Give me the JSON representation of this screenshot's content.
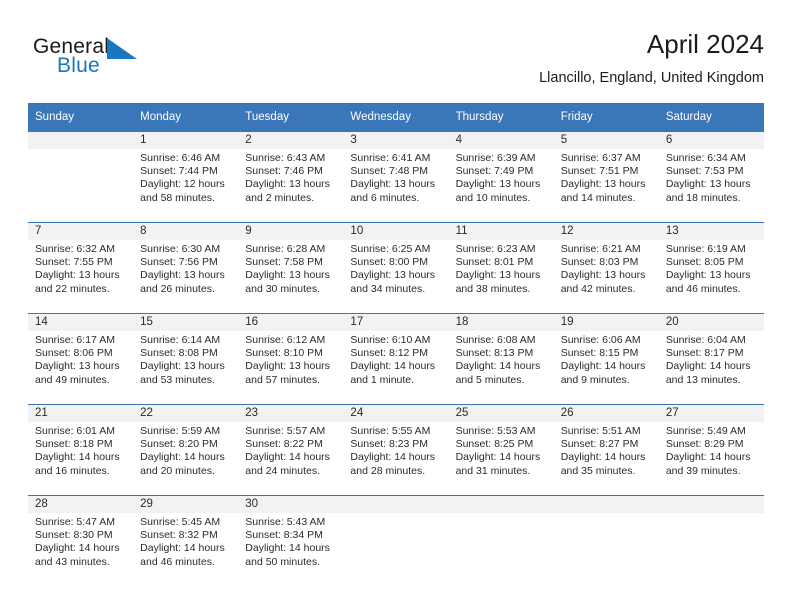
{
  "brand": {
    "name_part1": "General",
    "name_part2": "Blue",
    "flag_icon": "blue-triangle-flag-icon",
    "accent_color": "#1878be"
  },
  "header": {
    "title": "April 2024",
    "location": "Llancillo, England, United Kingdom"
  },
  "theme": {
    "header_blue": "#3a76b8",
    "daynum_band_gray": "#f2f2f2",
    "text": "#2b2b2b"
  },
  "calendar": {
    "weekday_headers": [
      "Sunday",
      "Monday",
      "Tuesday",
      "Wednesday",
      "Thursday",
      "Friday",
      "Saturday"
    ],
    "weeks": [
      [
        {
          "day": "",
          "sunrise": "",
          "sunset": "",
          "daylight_line1": "",
          "daylight_line2": "",
          "blank": true
        },
        {
          "day": "1",
          "sunrise": "Sunrise: 6:46 AM",
          "sunset": "Sunset: 7:44 PM",
          "daylight_line1": "Daylight: 12 hours",
          "daylight_line2": "and 58 minutes."
        },
        {
          "day": "2",
          "sunrise": "Sunrise: 6:43 AM",
          "sunset": "Sunset: 7:46 PM",
          "daylight_line1": "Daylight: 13 hours",
          "daylight_line2": "and 2 minutes."
        },
        {
          "day": "3",
          "sunrise": "Sunrise: 6:41 AM",
          "sunset": "Sunset: 7:48 PM",
          "daylight_line1": "Daylight: 13 hours",
          "daylight_line2": "and 6 minutes."
        },
        {
          "day": "4",
          "sunrise": "Sunrise: 6:39 AM",
          "sunset": "Sunset: 7:49 PM",
          "daylight_line1": "Daylight: 13 hours",
          "daylight_line2": "and 10 minutes."
        },
        {
          "day": "5",
          "sunrise": "Sunrise: 6:37 AM",
          "sunset": "Sunset: 7:51 PM",
          "daylight_line1": "Daylight: 13 hours",
          "daylight_line2": "and 14 minutes."
        },
        {
          "day": "6",
          "sunrise": "Sunrise: 6:34 AM",
          "sunset": "Sunset: 7:53 PM",
          "daylight_line1": "Daylight: 13 hours",
          "daylight_line2": "and 18 minutes."
        }
      ],
      [
        {
          "day": "7",
          "sunrise": "Sunrise: 6:32 AM",
          "sunset": "Sunset: 7:55 PM",
          "daylight_line1": "Daylight: 13 hours",
          "daylight_line2": "and 22 minutes."
        },
        {
          "day": "8",
          "sunrise": "Sunrise: 6:30 AM",
          "sunset": "Sunset: 7:56 PM",
          "daylight_line1": "Daylight: 13 hours",
          "daylight_line2": "and 26 minutes."
        },
        {
          "day": "9",
          "sunrise": "Sunrise: 6:28 AM",
          "sunset": "Sunset: 7:58 PM",
          "daylight_line1": "Daylight: 13 hours",
          "daylight_line2": "and 30 minutes."
        },
        {
          "day": "10",
          "sunrise": "Sunrise: 6:25 AM",
          "sunset": "Sunset: 8:00 PM",
          "daylight_line1": "Daylight: 13 hours",
          "daylight_line2": "and 34 minutes."
        },
        {
          "day": "11",
          "sunrise": "Sunrise: 6:23 AM",
          "sunset": "Sunset: 8:01 PM",
          "daylight_line1": "Daylight: 13 hours",
          "daylight_line2": "and 38 minutes."
        },
        {
          "day": "12",
          "sunrise": "Sunrise: 6:21 AM",
          "sunset": "Sunset: 8:03 PM",
          "daylight_line1": "Daylight: 13 hours",
          "daylight_line2": "and 42 minutes."
        },
        {
          "day": "13",
          "sunrise": "Sunrise: 6:19 AM",
          "sunset": "Sunset: 8:05 PM",
          "daylight_line1": "Daylight: 13 hours",
          "daylight_line2": "and 46 minutes."
        }
      ],
      [
        {
          "day": "14",
          "sunrise": "Sunrise: 6:17 AM",
          "sunset": "Sunset: 8:06 PM",
          "daylight_line1": "Daylight: 13 hours",
          "daylight_line2": "and 49 minutes."
        },
        {
          "day": "15",
          "sunrise": "Sunrise: 6:14 AM",
          "sunset": "Sunset: 8:08 PM",
          "daylight_line1": "Daylight: 13 hours",
          "daylight_line2": "and 53 minutes."
        },
        {
          "day": "16",
          "sunrise": "Sunrise: 6:12 AM",
          "sunset": "Sunset: 8:10 PM",
          "daylight_line1": "Daylight: 13 hours",
          "daylight_line2": "and 57 minutes."
        },
        {
          "day": "17",
          "sunrise": "Sunrise: 6:10 AM",
          "sunset": "Sunset: 8:12 PM",
          "daylight_line1": "Daylight: 14 hours",
          "daylight_line2": "and 1 minute."
        },
        {
          "day": "18",
          "sunrise": "Sunrise: 6:08 AM",
          "sunset": "Sunset: 8:13 PM",
          "daylight_line1": "Daylight: 14 hours",
          "daylight_line2": "and 5 minutes."
        },
        {
          "day": "19",
          "sunrise": "Sunrise: 6:06 AM",
          "sunset": "Sunset: 8:15 PM",
          "daylight_line1": "Daylight: 14 hours",
          "daylight_line2": "and 9 minutes."
        },
        {
          "day": "20",
          "sunrise": "Sunrise: 6:04 AM",
          "sunset": "Sunset: 8:17 PM",
          "daylight_line1": "Daylight: 14 hours",
          "daylight_line2": "and 13 minutes."
        }
      ],
      [
        {
          "day": "21",
          "sunrise": "Sunrise: 6:01 AM",
          "sunset": "Sunset: 8:18 PM",
          "daylight_line1": "Daylight: 14 hours",
          "daylight_line2": "and 16 minutes."
        },
        {
          "day": "22",
          "sunrise": "Sunrise: 5:59 AM",
          "sunset": "Sunset: 8:20 PM",
          "daylight_line1": "Daylight: 14 hours",
          "daylight_line2": "and 20 minutes."
        },
        {
          "day": "23",
          "sunrise": "Sunrise: 5:57 AM",
          "sunset": "Sunset: 8:22 PM",
          "daylight_line1": "Daylight: 14 hours",
          "daylight_line2": "and 24 minutes."
        },
        {
          "day": "24",
          "sunrise": "Sunrise: 5:55 AM",
          "sunset": "Sunset: 8:23 PM",
          "daylight_line1": "Daylight: 14 hours",
          "daylight_line2": "and 28 minutes."
        },
        {
          "day": "25",
          "sunrise": "Sunrise: 5:53 AM",
          "sunset": "Sunset: 8:25 PM",
          "daylight_line1": "Daylight: 14 hours",
          "daylight_line2": "and 31 minutes."
        },
        {
          "day": "26",
          "sunrise": "Sunrise: 5:51 AM",
          "sunset": "Sunset: 8:27 PM",
          "daylight_line1": "Daylight: 14 hours",
          "daylight_line2": "and 35 minutes."
        },
        {
          "day": "27",
          "sunrise": "Sunrise: 5:49 AM",
          "sunset": "Sunset: 8:29 PM",
          "daylight_line1": "Daylight: 14 hours",
          "daylight_line2": "and 39 minutes."
        }
      ],
      [
        {
          "day": "28",
          "sunrise": "Sunrise: 5:47 AM",
          "sunset": "Sunset: 8:30 PM",
          "daylight_line1": "Daylight: 14 hours",
          "daylight_line2": "and 43 minutes."
        },
        {
          "day": "29",
          "sunrise": "Sunrise: 5:45 AM",
          "sunset": "Sunset: 8:32 PM",
          "daylight_line1": "Daylight: 14 hours",
          "daylight_line2": "and 46 minutes."
        },
        {
          "day": "30",
          "sunrise": "Sunrise: 5:43 AM",
          "sunset": "Sunset: 8:34 PM",
          "daylight_line1": "Daylight: 14 hours",
          "daylight_line2": "and 50 minutes."
        },
        {
          "day": "",
          "sunrise": "",
          "sunset": "",
          "daylight_line1": "",
          "daylight_line2": "",
          "blank": true
        },
        {
          "day": "",
          "sunrise": "",
          "sunset": "",
          "daylight_line1": "",
          "daylight_line2": "",
          "blank": true
        },
        {
          "day": "",
          "sunrise": "",
          "sunset": "",
          "daylight_line1": "",
          "daylight_line2": "",
          "blank": true
        },
        {
          "day": "",
          "sunrise": "",
          "sunset": "",
          "daylight_line1": "",
          "daylight_line2": "",
          "blank": true
        }
      ]
    ]
  }
}
